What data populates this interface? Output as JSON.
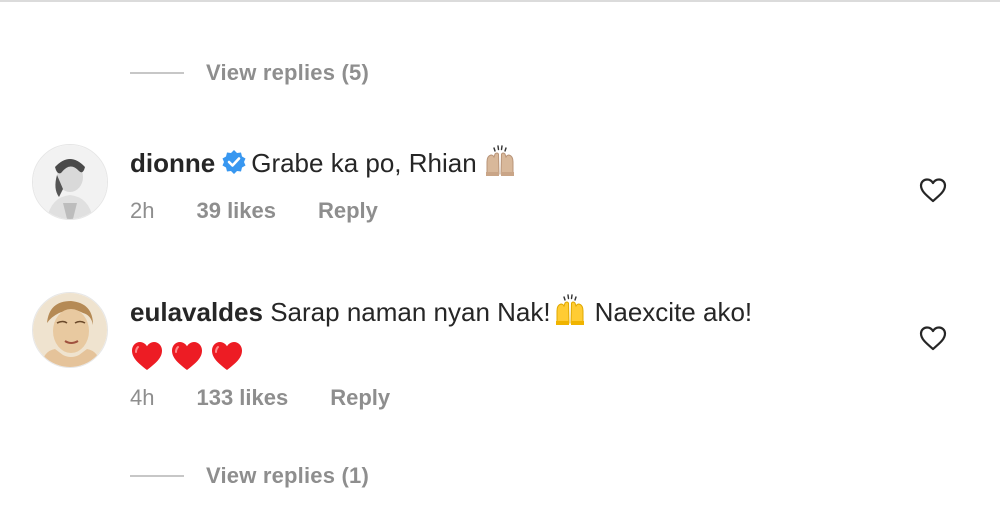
{
  "thread": {
    "view_replies_top": "View replies (5)",
    "view_replies_bottom": "View replies (1)"
  },
  "comments": [
    {
      "username": "dionne",
      "verified": true,
      "text": "Grabe ka po, Rhian",
      "emoji": "raising-hands-light-skin",
      "time": "2h",
      "likes": "39 likes",
      "reply_label": "Reply"
    },
    {
      "username": "eulavaldes",
      "verified": false,
      "text_before": "Sarap naman nyan Nak!",
      "emoji": "raising-hands",
      "text_after": "Naexcite ako!",
      "hearts": [
        "red-heart",
        "red-heart",
        "red-heart"
      ],
      "time": "4h",
      "likes": "133 likes",
      "reply_label": "Reply"
    }
  ],
  "colors": {
    "text_primary": "#262626",
    "text_secondary": "#8e8e8e",
    "verified_blue": "#3897f0",
    "heart_red": "#ed1c24",
    "divider": "#dbdbdb"
  }
}
